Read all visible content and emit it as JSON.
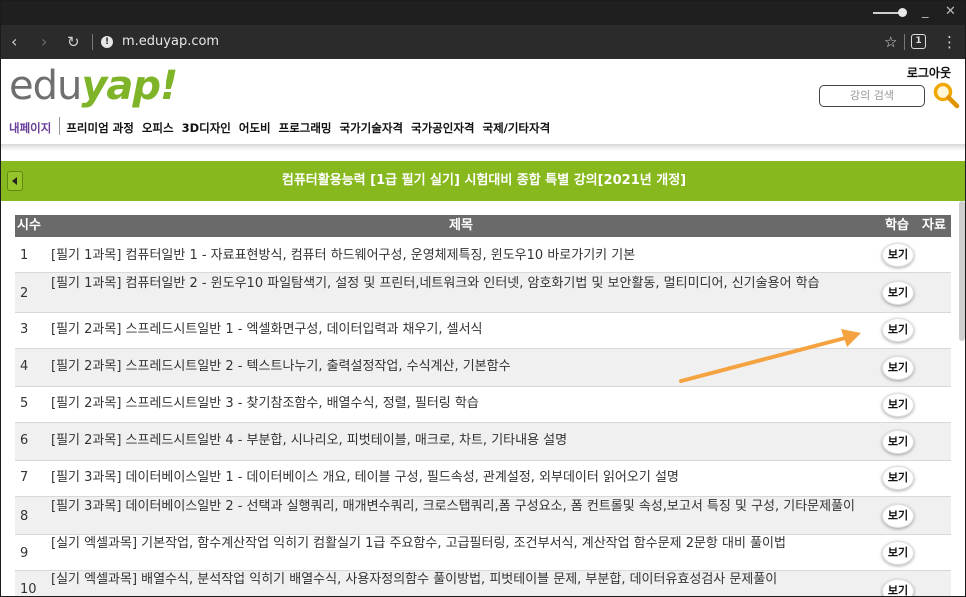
{
  "browser": {
    "url": "m.eduyap.com",
    "minimize": "_",
    "close": "✕",
    "tab_count": "1"
  },
  "header": {
    "logo_edu": "edu",
    "logo_yap": "yap!",
    "logout": "로그아웃",
    "search_placeholder": "강의 검색"
  },
  "menu": {
    "items": [
      "내페이지",
      "프리미엄 과정",
      "오피스",
      "3D디자인",
      "어도비",
      "프로그래밍",
      "국가기술자격",
      "국가공인자격",
      "국제/기타자격"
    ]
  },
  "banner": {
    "title": "컴퓨터활용능력 [1급 필기 실기] 시험대비 종합 특별 강의[2021년 개정]"
  },
  "table": {
    "headers": {
      "no": "시수",
      "title": "제목",
      "learn": "학습",
      "material": "자료"
    },
    "button_label": "보기",
    "rows": [
      {
        "no": "1",
        "title": "[필기 1과목] 컴퓨터일반 1 - 자료표현방식, 컴퓨터 하드웨어구성, 운영체제특징, 윈도우10 바로가기키 기본"
      },
      {
        "no": "2",
        "title": "[필기 1과목] 컴퓨터일반 2 - 윈도우10 파일탐색기, 설정 및 프린터,네트워크와 인터넷, 암호화기법 및 보안활동, 멀티미디어, 신기술용어 학습"
      },
      {
        "no": "3",
        "title": "[필기 2과목] 스프레드시트일반 1 - 엑셀화면구성, 데이터입력과 채우기, 셀서식"
      },
      {
        "no": "4",
        "title": "[필기 2과목] 스프레드시트일반 2 - 텍스트나누기, 출력설정작업, 수식계산, 기본함수"
      },
      {
        "no": "5",
        "title": "[필기 2과목] 스프레드시트일반 3 - 찾기참조함수, 배열수식, 정렬, 필터링 학습"
      },
      {
        "no": "6",
        "title": "[필기 2과목] 스프레드시트일반 4 - 부분합, 시나리오, 피벗테이블, 매크로, 차트, 기타내용 설명"
      },
      {
        "no": "7",
        "title": "[필기 3과목] 데이터베이스일반 1 - 데이터베이스 개요, 테이블 구성, 필드속성, 관계설정, 외부데이터 읽어오기 설명"
      },
      {
        "no": "8",
        "title": "[필기 3과목] 데이터베이스일반 2 - 선택과 실행쿼리, 매개변수쿼리, 크로스탭쿼리,폼 구성요소, 폼 컨트롤및 속성,보고서 특징 및 구성, 기타문제풀이"
      },
      {
        "no": "9",
        "title": "[실기 엑셀과목] 기본작업, 함수계산작업 익히기 컴활실기 1급 주요함수, 고급필터링, 조건부서식, 계산작업 함수문제 2문항 대비 풀이법"
      },
      {
        "no": "10",
        "title": "[실기 엑셀과목] 배열수식, 분석작업 익히기 배열수식, 사용자정의함수 풀이방법, 피벗테이블 문제, 부분합, 데이터유효성검사 문제풀이"
      }
    ]
  },
  "colors": {
    "banner": "#87b81e",
    "logo_green": "#7fb428",
    "annotation_arrow": "#f4a340"
  }
}
